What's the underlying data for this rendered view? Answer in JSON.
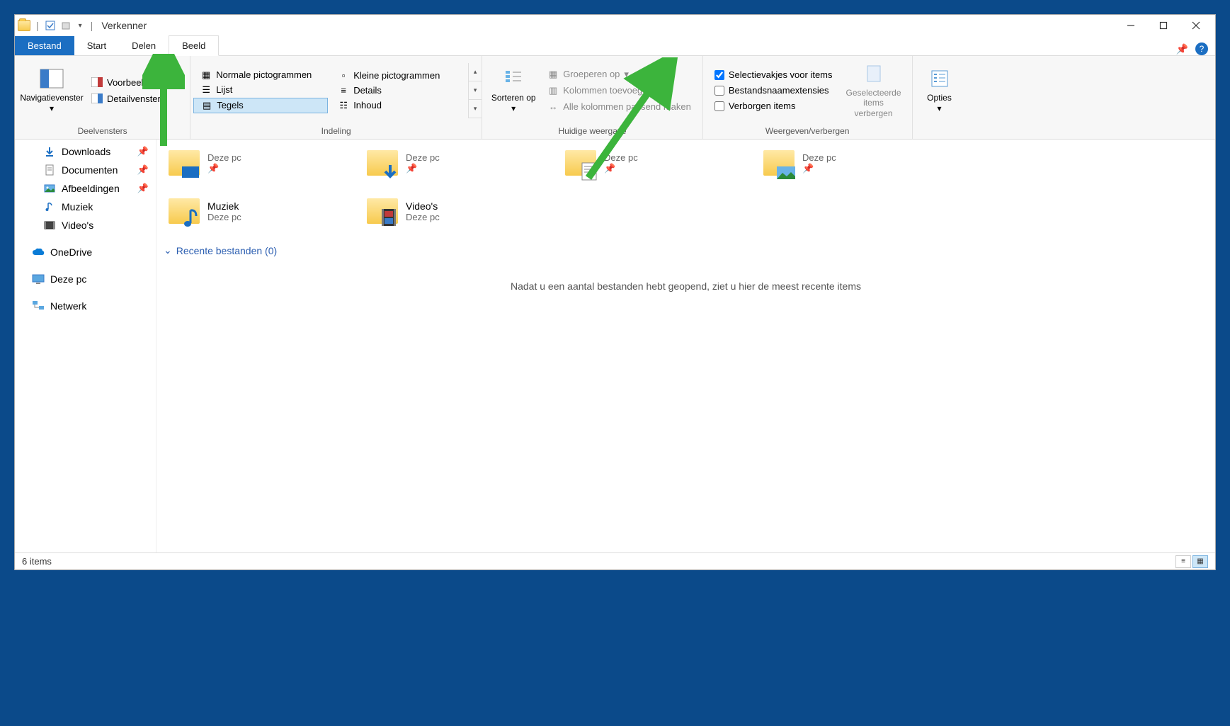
{
  "title": "Verkenner",
  "tabs": {
    "file": "Bestand",
    "home": "Start",
    "share": "Delen",
    "view": "Beeld"
  },
  "ribbon": {
    "panes": {
      "label": "Deelvensters",
      "nav": "Navigatievenster",
      "preview": "Voorbeeldvenster",
      "details": "Detailvenster"
    },
    "layout": {
      "label": "Indeling",
      "normal": "Normale pictogrammen",
      "small": "Kleine pictogrammen",
      "list": "Lijst",
      "details": "Details",
      "tiles": "Tegels",
      "content": "Inhoud"
    },
    "current": {
      "label": "Huidige weergave",
      "sort": "Sorteren op",
      "group": "Groeperen op",
      "addcols": "Kolommen toevoegen",
      "fitcols": "Alle kolommen passend maken"
    },
    "showhide": {
      "label": "Weergeven/verbergen",
      "checkboxes": "Selectievakjes voor items",
      "extensions": "Bestandsnaamextensies",
      "hidden": "Verborgen items",
      "hidesel": "Geselecteerde items verbergen"
    },
    "options": "Opties"
  },
  "sidebar": [
    {
      "label": "Downloads",
      "pinned": true,
      "icon": "download"
    },
    {
      "label": "Documenten",
      "pinned": true,
      "icon": "doc"
    },
    {
      "label": "Afbeeldingen",
      "pinned": true,
      "icon": "pic"
    },
    {
      "label": "Muziek",
      "pinned": false,
      "icon": "music"
    },
    {
      "label": "Video's",
      "pinned": false,
      "icon": "video"
    }
  ],
  "sidebar_roots": [
    {
      "label": "OneDrive",
      "icon": "cloud"
    },
    {
      "label": "Deze pc",
      "icon": "pc"
    },
    {
      "label": "Netwerk",
      "icon": "network"
    }
  ],
  "tiles": [
    {
      "name": "",
      "sub": "Deze pc",
      "icon": "desktop"
    },
    {
      "name": "",
      "sub": "Deze pc",
      "icon": "download"
    },
    {
      "name": "",
      "sub": "Deze pc",
      "icon": "doc"
    },
    {
      "name": "",
      "sub": "Deze pc",
      "icon": "pic"
    },
    {
      "name": "Muziek",
      "sub": "Deze pc",
      "icon": "music"
    },
    {
      "name": "Video's",
      "sub": "Deze pc",
      "icon": "video"
    }
  ],
  "recent": {
    "header": "Recente bestanden (0)",
    "empty": "Nadat u een aantal bestanden hebt geopend, ziet u hier de meest recente items"
  },
  "status": "6 items"
}
